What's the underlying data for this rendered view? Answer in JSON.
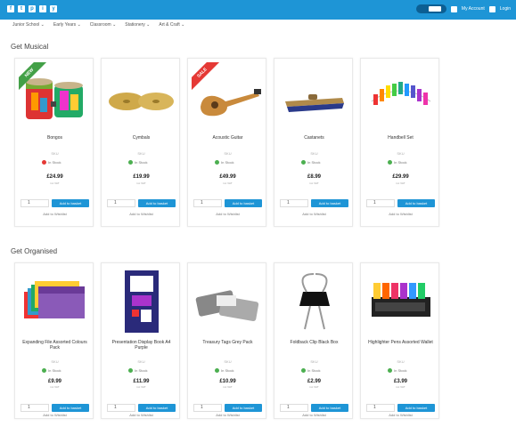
{
  "topbar": {
    "social_icons": [
      "facebook-icon",
      "twitter-icon",
      "pinterest-icon",
      "instagram-icon",
      "youtube-icon"
    ],
    "search_label": "Search",
    "account_label": "My Account",
    "login_label": "Login"
  },
  "nav": {
    "items": [
      "Junior School",
      "Early Years",
      "Classroom",
      "Stationery",
      "Art & Craft"
    ]
  },
  "sections": [
    {
      "title": "Get Musical",
      "products": [
        {
          "name": "Bongos",
          "sku": "SKU",
          "stock": "In Stock",
          "stock_color": "#e53935",
          "price": "£24.99",
          "tax": "inc VAT",
          "qty": "1",
          "add_label": "Add to basket",
          "list_label": "Add to Wishlist",
          "ribbon": "NEW",
          "ribbon_color": "#43a047"
        },
        {
          "name": "Cymbals",
          "sku": "SKU",
          "stock": "In Stock",
          "stock_color": "#4caf50",
          "price": "£19.99",
          "tax": "inc VAT",
          "qty": "1",
          "add_label": "Add to basket",
          "list_label": "Add to Wishlist",
          "ribbon": "",
          "ribbon_color": ""
        },
        {
          "name": "Acoustic Guitar",
          "sku": "SKU",
          "stock": "In Stock",
          "stock_color": "#4caf50",
          "price": "£49.99",
          "tax": "inc VAT",
          "qty": "1",
          "add_label": "Add to basket",
          "list_label": "Add to Wishlist",
          "ribbon": "SALE",
          "ribbon_color": "#e53935"
        },
        {
          "name": "Castanets",
          "sku": "SKU",
          "stock": "In Stock",
          "stock_color": "#4caf50",
          "price": "£8.99",
          "tax": "inc VAT",
          "qty": "1",
          "add_label": "Add to basket",
          "list_label": "Add to Wishlist",
          "ribbon": "",
          "ribbon_color": ""
        },
        {
          "name": "Handbell Set",
          "sku": "SKU",
          "stock": "In Stock",
          "stock_color": "#4caf50",
          "price": "£29.99",
          "tax": "inc VAT",
          "qty": "1",
          "add_label": "Add to basket",
          "list_label": "Add to Wishlist",
          "ribbon": "",
          "ribbon_color": ""
        }
      ]
    },
    {
      "title": "Get Organised",
      "products": [
        {
          "name": "Expanding File Assorted Colours Pack",
          "sku": "SKU",
          "stock": "In Stock",
          "stock_color": "#4caf50",
          "price": "£9.99",
          "tax": "inc VAT",
          "qty": "1",
          "add_label": "Add to basket",
          "list_label": "Add to Wishlist",
          "ribbon": "",
          "ribbon_color": ""
        },
        {
          "name": "Presentation Display Book A4 Purple",
          "sku": "SKU",
          "stock": "In Stock",
          "stock_color": "#4caf50",
          "price": "£11.99",
          "tax": "inc VAT",
          "qty": "1",
          "add_label": "Add to basket",
          "list_label": "Add to Wishlist",
          "ribbon": "",
          "ribbon_color": ""
        },
        {
          "name": "Treasury Tags Grey Pack",
          "sku": "SKU",
          "stock": "In Stock",
          "stock_color": "#4caf50",
          "price": "£10.99",
          "tax": "inc VAT",
          "qty": "1",
          "add_label": "Add to basket",
          "list_label": "Add to Wishlist",
          "ribbon": "",
          "ribbon_color": ""
        },
        {
          "name": "Foldback Clip Black Box",
          "sku": "SKU",
          "stock": "In Stock",
          "stock_color": "#4caf50",
          "price": "£2.99",
          "tax": "inc VAT",
          "qty": "1",
          "add_label": "Add to basket",
          "list_label": "Add to Wishlist",
          "ribbon": "",
          "ribbon_color": ""
        },
        {
          "name": "Highlighter Pens Assorted Wallet",
          "sku": "SKU",
          "stock": "In Stock",
          "stock_color": "#4caf50",
          "price": "£3.99",
          "tax": "inc VAT",
          "qty": "1",
          "add_label": "Add to basket",
          "list_label": "Add to Wishlist",
          "ribbon": "",
          "ribbon_color": ""
        }
      ]
    }
  ]
}
